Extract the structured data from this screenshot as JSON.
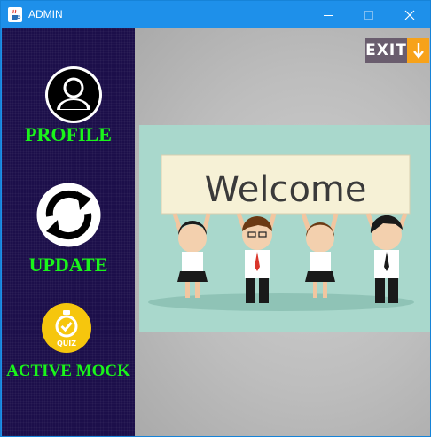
{
  "window": {
    "title": "ADMIN"
  },
  "sidebar": {
    "items": [
      {
        "label": "PROFILE",
        "icon": "user-profile-icon"
      },
      {
        "label": "UPDATE",
        "icon": "refresh-icon"
      },
      {
        "label": "ACTIVE MOCK",
        "icon": "quiz-stopwatch-icon"
      }
    ]
  },
  "quiz_badge_text": "QUIZ",
  "main": {
    "exit_label": "EXIT",
    "banner_text": "Welcome"
  },
  "colors": {
    "sidebar_bg": "#1c0f4a",
    "nav_label": "#1af51a",
    "titlebar": "#1e90ea",
    "exit_bg": "#6a5d6e",
    "exit_accent": "#f7a21a",
    "banner_bg": "#a9d8cc"
  }
}
